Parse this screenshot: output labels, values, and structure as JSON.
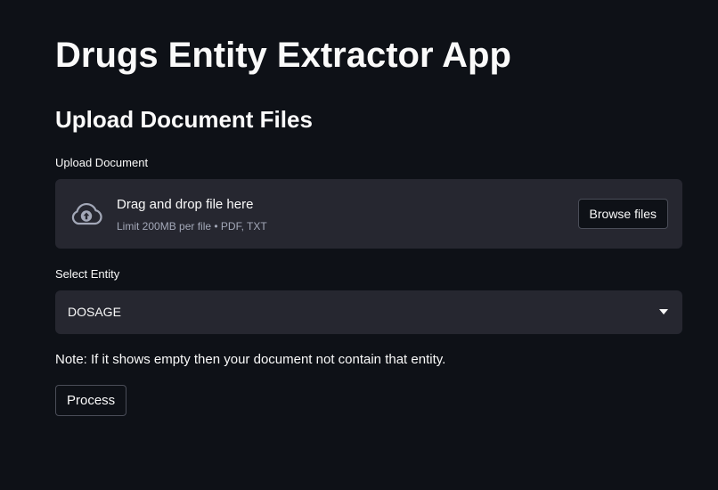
{
  "page": {
    "title": "Drugs Entity Extractor App",
    "section_title": "Upload Document Files"
  },
  "uploader": {
    "label": "Upload Document",
    "drop_text": "Drag and drop file here",
    "hint": "Limit 200MB per file • PDF, TXT",
    "browse_label": "Browse files",
    "icon": "cloud-upload-icon"
  },
  "entity_select": {
    "label": "Select Entity",
    "selected_value": "DOSAGE",
    "icon": "caret-down-icon"
  },
  "note": "Note: If it shows empty then your document not contain that entity.",
  "process_label": "Process",
  "colors": {
    "background": "#0e1117",
    "widget_background": "#262730",
    "text": "#fafafa",
    "muted_text": "#a3a8b8",
    "button_border": "#4a4d58"
  }
}
